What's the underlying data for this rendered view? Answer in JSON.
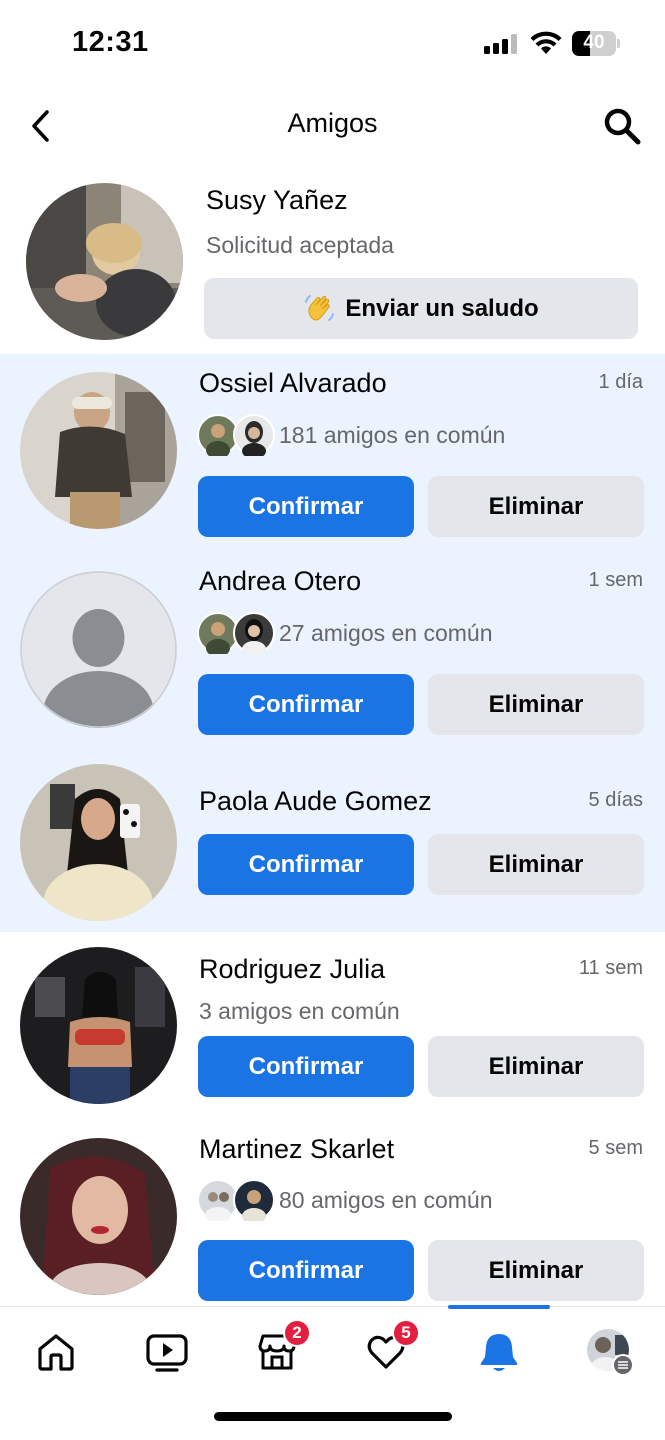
{
  "status_bar": {
    "time": "12:31",
    "battery": "40",
    "battery_level": 0.4
  },
  "header": {
    "title": "Amigos",
    "back_icon": "chevron-left-icon",
    "search_icon": "search-icon"
  },
  "accepted": {
    "name": "Susy Yañez",
    "status": "Solicitud aceptada",
    "wave_label": "Enviar un saludo",
    "wave_icon": "waving-hand-icon"
  },
  "requests": [
    {
      "name": "Ossiel Alvarado",
      "time": "1 día",
      "mutual": "181 amigos en común",
      "unread": true,
      "confirm": "Confirmar",
      "delete": "Eliminar"
    },
    {
      "name": "Andrea Otero",
      "time": "1 sem",
      "mutual": "27 amigos en común",
      "unread": true,
      "confirm": "Confirmar",
      "delete": "Eliminar"
    },
    {
      "name": "Paola Aude Gomez",
      "time": "5 días",
      "mutual": "",
      "unread": true,
      "confirm": "Confirmar",
      "delete": "Eliminar"
    },
    {
      "name": "Rodriguez Julia",
      "time": "11 sem",
      "mutual": "3 amigos en común",
      "unread": false,
      "confirm": "Confirmar",
      "delete": "Eliminar"
    },
    {
      "name": "Martinez Skarlet",
      "time": "5 sem",
      "mutual": "80 amigos en común",
      "unread": false,
      "confirm": "Confirmar",
      "delete": "Eliminar"
    }
  ],
  "bottom_nav": {
    "items": [
      {
        "icon": "home-icon",
        "badge": ""
      },
      {
        "icon": "video-icon",
        "badge": ""
      },
      {
        "icon": "marketplace-icon",
        "badge": "2"
      },
      {
        "icon": "dating-heart-icon",
        "badge": "5"
      },
      {
        "icon": "bell-icon",
        "badge": "",
        "active": true
      },
      {
        "icon": "profile-menu-icon",
        "badge": ""
      }
    ]
  },
  "colors": {
    "primary": "#1b74e4",
    "unread_bg": "#ebf3ff",
    "secondary_btn": "#e4e6eb",
    "badge": "#e41e3f",
    "muted_text": "#65676b"
  }
}
